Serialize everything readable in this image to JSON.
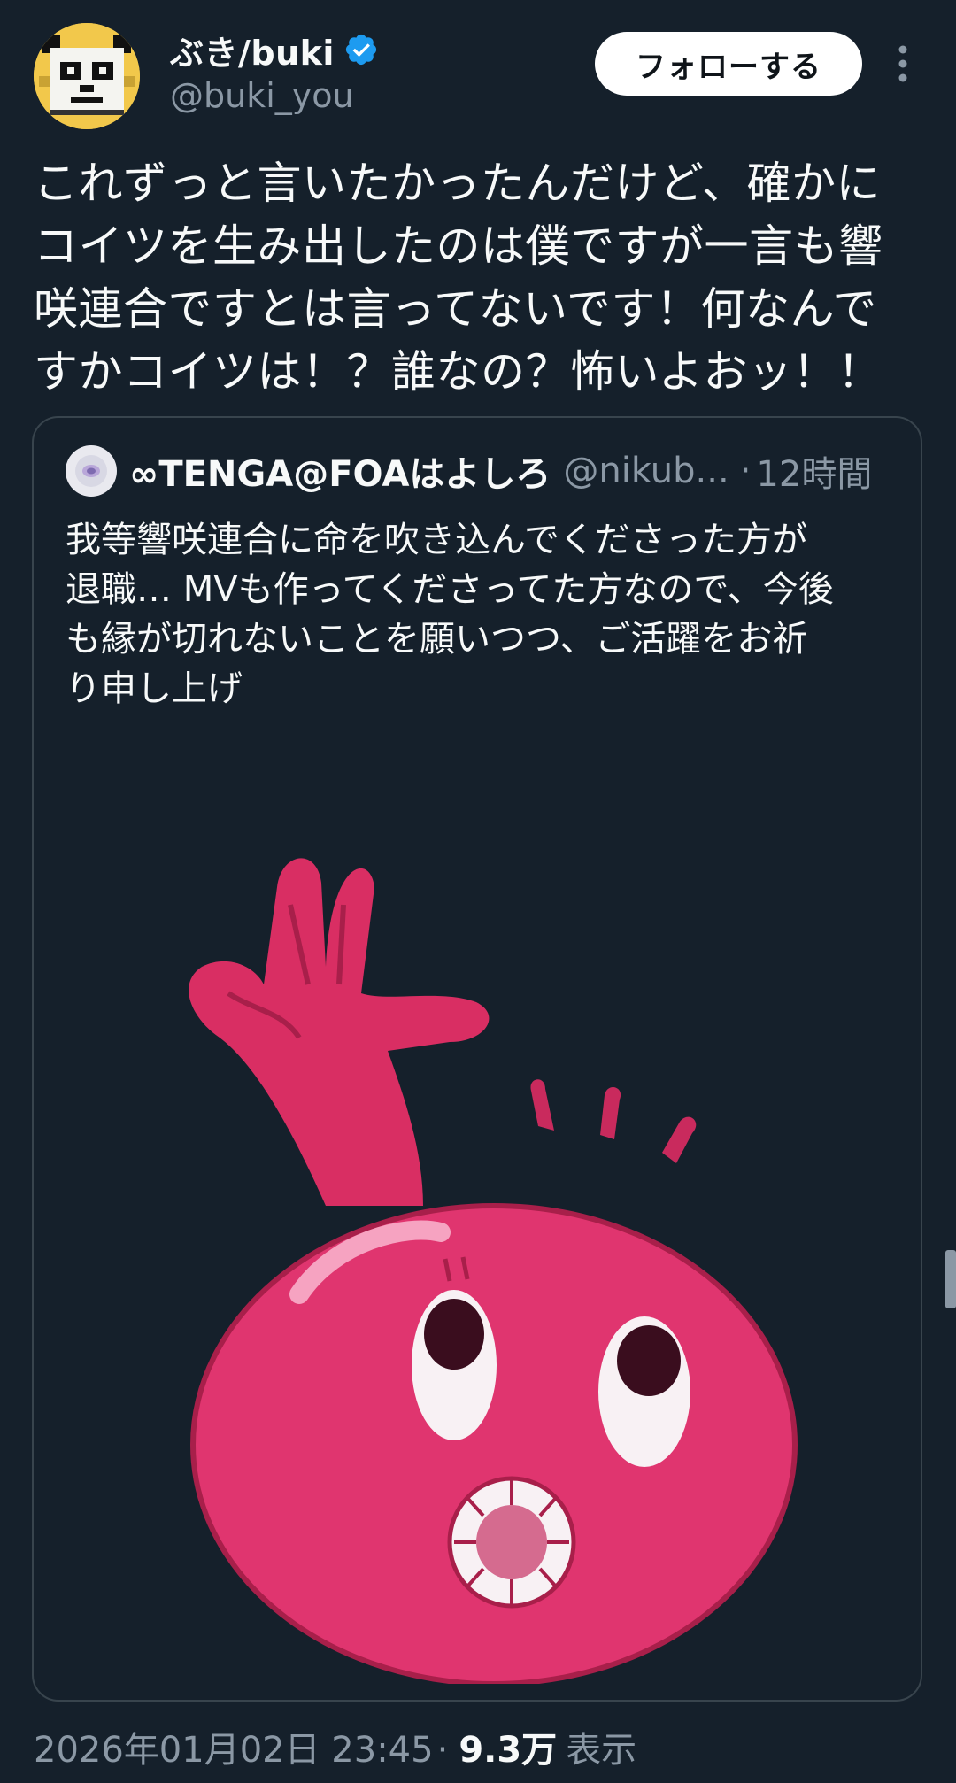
{
  "author": {
    "display_name": "ぶき/buki",
    "handle": "@buki_you",
    "verified": true,
    "avatar_icon": "pixel-panda-avatar"
  },
  "actions": {
    "follow_label": "フォローする",
    "more_icon": "more-vertical-icon"
  },
  "tweet": {
    "text": "これずっと言いたかったんだけど、確かに\nコイツを生み出したのは僕ですが一言も響\n咲連合ですとは言ってないです！何なんで\nすかコイツは！？誰なの？怖いよおッ！！"
  },
  "quote": {
    "display_name": "∞TENGA@FOAはよしろ",
    "handle": "@nikub...",
    "separator": "·",
    "time": "12時間",
    "text": "我等響咲連合に命を吹き込んでくださった方が\n退職… MVも作ってくださってた方なので、今後\nも縁が切れないことを願いつつ、ご活躍をお祈\nり申し上げ",
    "media_icon": "pink-blob-character-illustration"
  },
  "footer": {
    "timestamp": "2026年01月02日 23:45",
    "separator": "·",
    "views_count": "9.3万",
    "views_label": "表示"
  },
  "colors": {
    "background": "#15202b",
    "text": "#f7f9f9",
    "secondary_text": "#8b98a5",
    "verified": "#1d9bf0",
    "character_pink": "#e0356f"
  }
}
